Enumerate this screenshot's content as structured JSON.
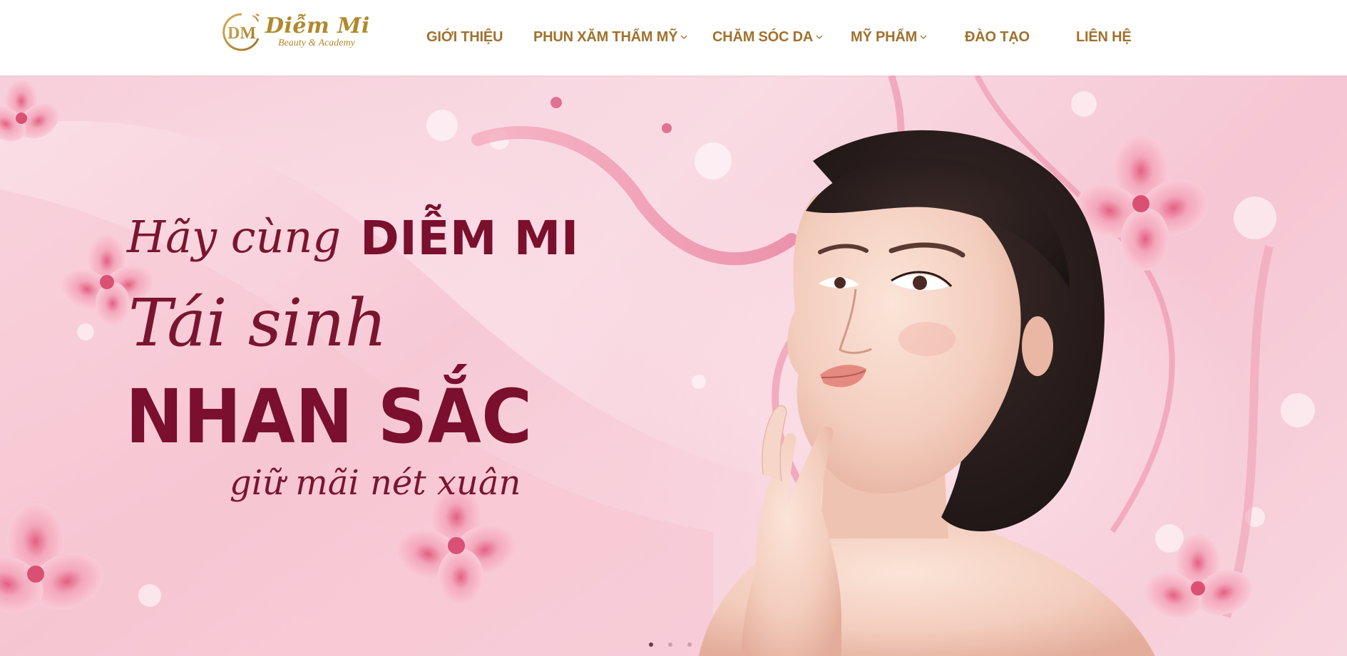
{
  "brand": {
    "name": "Diễm Mi",
    "tagline": "Beauty & Academy",
    "monogram": "DM",
    "gold": "#b0892c"
  },
  "nav": {
    "items": [
      {
        "label": "GIỚI THIỆU",
        "has_dropdown": false
      },
      {
        "label": "PHUN XĂM THẨM MỸ",
        "has_dropdown": true
      },
      {
        "label": "CHĂM SÓC DA",
        "has_dropdown": true
      },
      {
        "label": "MỸ PHẨM",
        "has_dropdown": true
      },
      {
        "label": "ĐÀO TẠO",
        "has_dropdown": false
      },
      {
        "label": "LIÊN HỆ",
        "has_dropdown": false
      }
    ],
    "color": "#a0712c"
  },
  "hero": {
    "line1_script": "Hãy cùng",
    "line1_bold": "DIỄM MI",
    "line2_script": "Tái sinh",
    "line3_bold": "NHAN SẮC",
    "line4_script": "giữ mãi nét xuân",
    "text_color": "#7a0f2e",
    "slides": 3,
    "active_slide": 1
  }
}
